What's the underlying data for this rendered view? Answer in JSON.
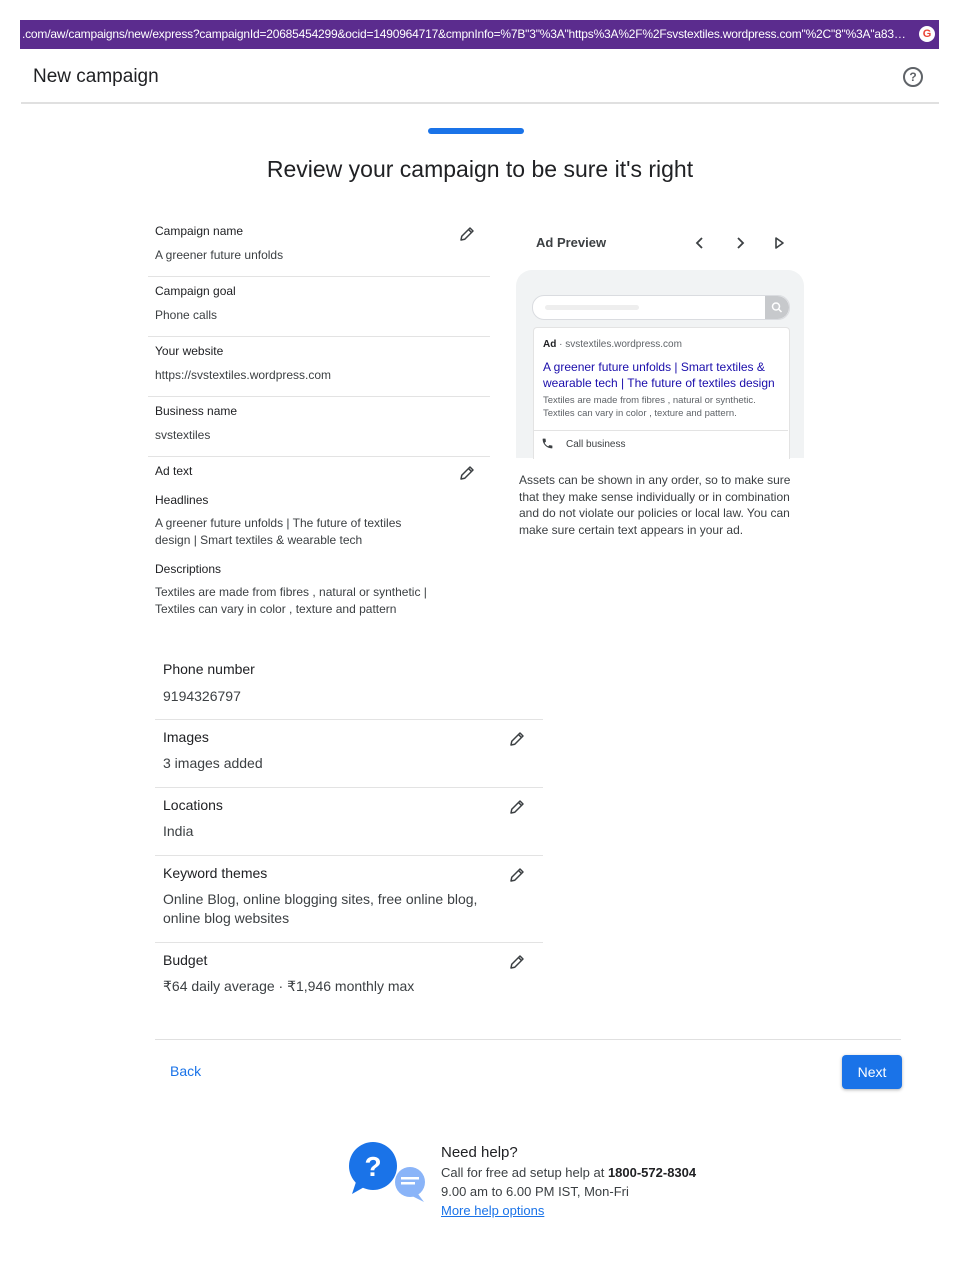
{
  "browser": {
    "url": ".com/aw/campaigns/new/express?campaignId=20685454299&ocid=1490964717&cmpnInfo=%7B\"3\"%3A\"https%3A%2F%2Fsvstextiles.wordpress.com\"%2C\"8\"%3A\"a83BD36..."
  },
  "header": {
    "title": "New campaign"
  },
  "page_title": "Review your campaign to be sure it's right",
  "review": {
    "campaign_name": {
      "label": "Campaign name",
      "value": "A greener future unfolds"
    },
    "campaign_goal": {
      "label": "Campaign goal",
      "value": "Phone calls"
    },
    "website": {
      "label": "Your website",
      "value": "https://svstextiles.wordpress.com"
    },
    "business_name": {
      "label": "Business name",
      "value": "svstextiles"
    },
    "ad_text": {
      "label": "Ad text",
      "headlines_label": "Headlines",
      "headlines": "A greener future unfolds | The future of textiles design | Smart textiles & wearable tech",
      "descriptions_label": "Descriptions",
      "descriptions": "Textiles are made from fibres , natural or synthetic | Textiles can vary in color , texture and pattern"
    },
    "phone_number": {
      "label": "Phone number",
      "value": "9194326797"
    },
    "images": {
      "label": "Images",
      "value": "3 images added"
    },
    "locations": {
      "label": "Locations",
      "value": "India"
    },
    "keyword_themes": {
      "label": "Keyword themes",
      "value": "Online Blog, online blogging sites, free online blog, online blog websites"
    },
    "budget": {
      "label": "Budget",
      "value": "₹64 daily average · ₹1,946 monthly max"
    }
  },
  "ad_preview": {
    "title": "Ad Preview",
    "ad_badge": "Ad",
    "ad_url": " · svstextiles.wordpress.com",
    "ad_headline": "A greener future unfolds | Smart textiles & wearable tech | The future of textiles design",
    "ad_description": "Textiles are made from fibres , natural or synthetic. Textiles can vary in color , texture and pattern.",
    "call_label": "Call business",
    "assets_note": "Assets can be shown in any order, so to make sure that they make sense individually or in combination and do not violate our policies or local law. You can make sure certain text appears in your ad."
  },
  "footer": {
    "back_label": "Back",
    "next_label": "Next"
  },
  "help": {
    "title": "Need help?",
    "call_text": "Call for free ad setup help at ",
    "phone": "1800-572-8304",
    "hours": "9.00 am to 6.00 PM IST, Mon-Fri",
    "link": "More help options"
  },
  "colors": {
    "accent": "#1a73e8",
    "urlbar": "#5b2c8e",
    "ad_link": "#1a0dab"
  },
  "icons": [
    "help-circle-icon",
    "pencil-icon",
    "chevron-left-icon",
    "chevron-right-icon",
    "play-icon",
    "search-icon",
    "phone-icon"
  ]
}
